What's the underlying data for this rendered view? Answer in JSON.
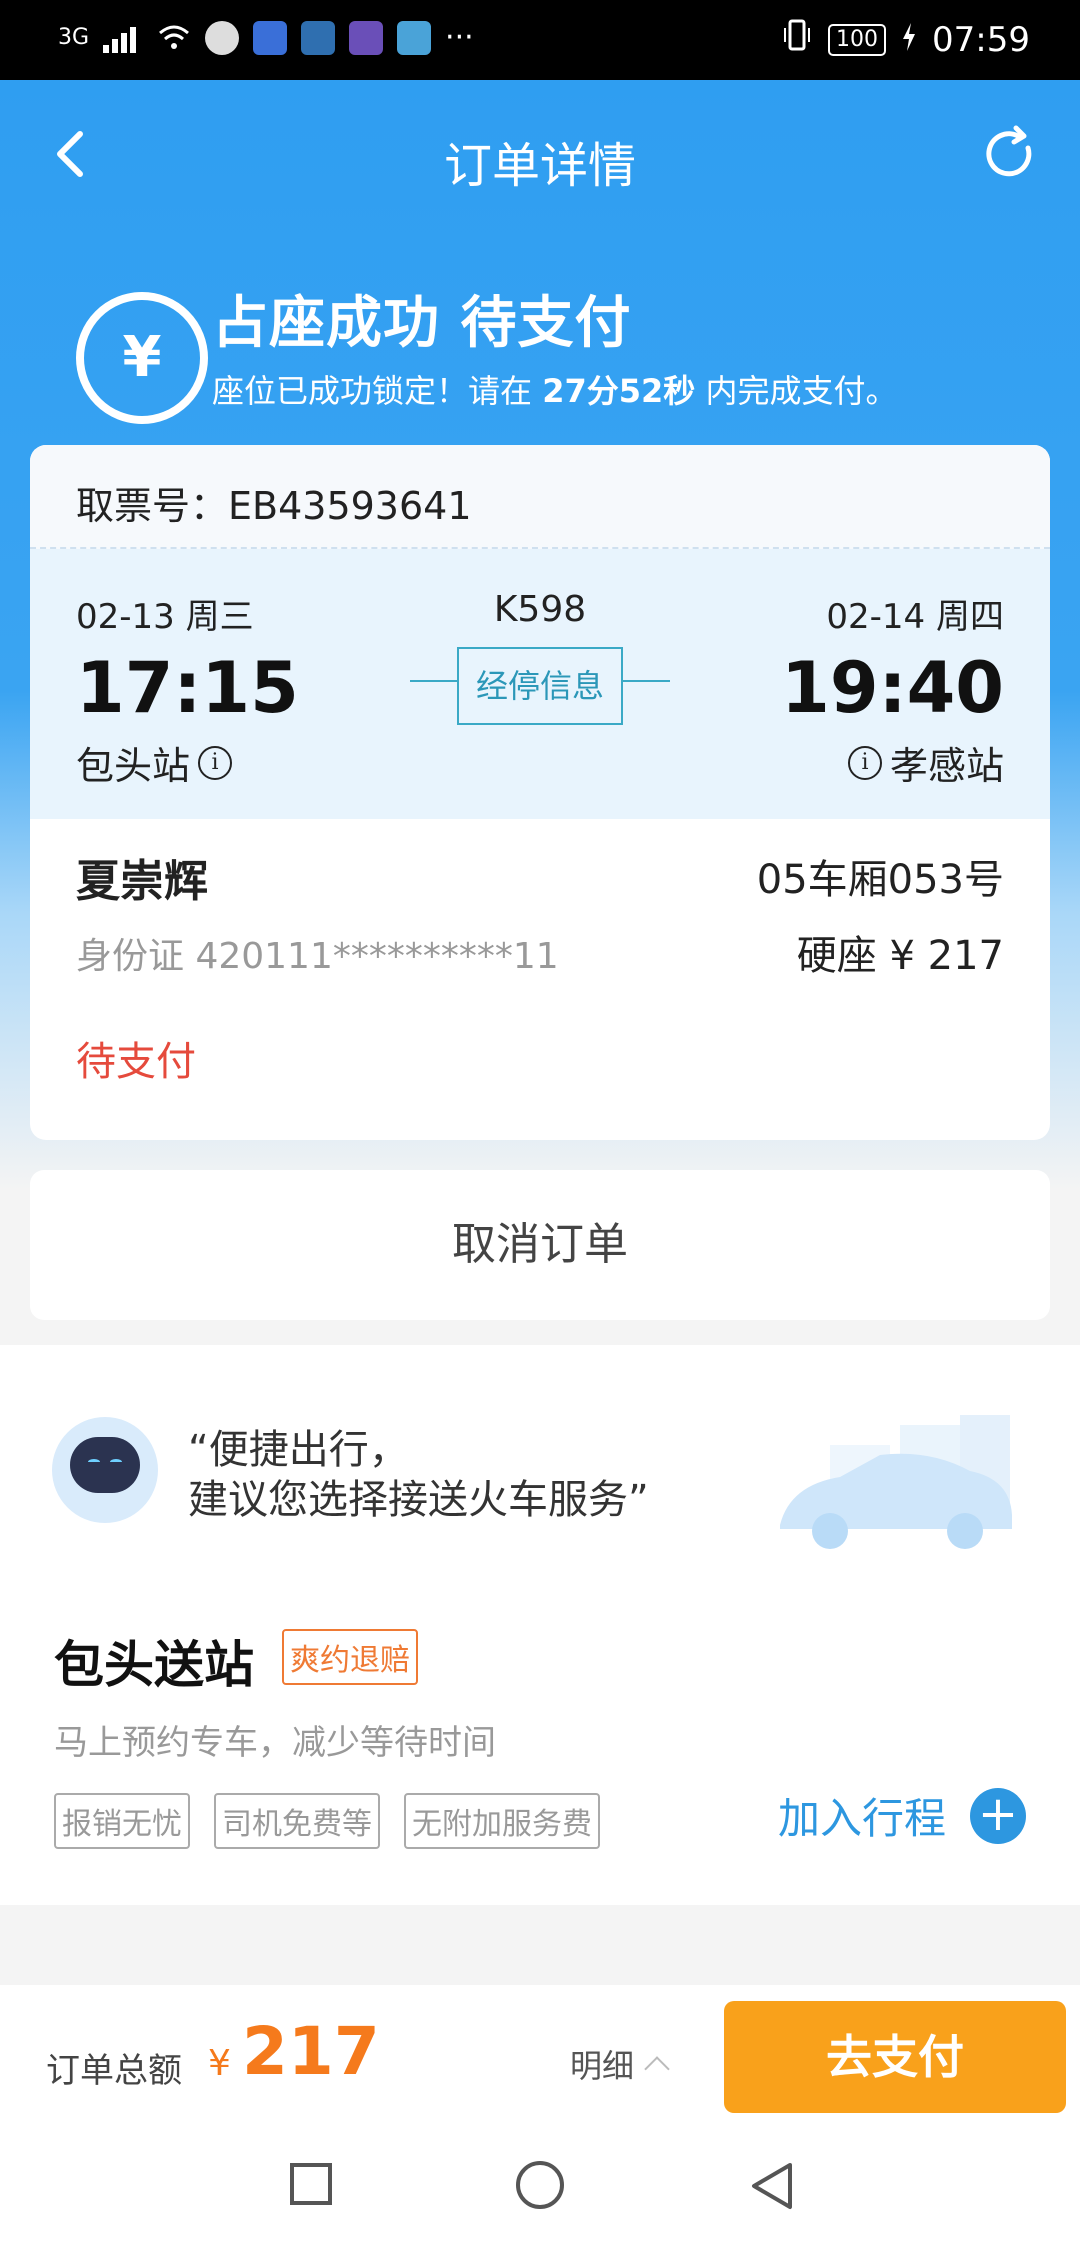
{
  "statusbar": {
    "network": "3G",
    "more": "···",
    "battery": "100",
    "time": "07:59"
  },
  "nav": {
    "title": "订单详情",
    "back_icon": "back-chevron-icon",
    "refresh_icon": "refresh-icon"
  },
  "order_status": {
    "icon": "yen",
    "title": "占座成功  待支付",
    "subtitle_prefix": "座位已成功锁定！请在 ",
    "countdown": "27分52秒",
    "subtitle_suffix": " 内完成支付。"
  },
  "ticket": {
    "ticket_no_label": "取票号：",
    "ticket_no": "EB43593641",
    "departure": {
      "date": "02-13  周三",
      "time": "17:15",
      "station": "包头站"
    },
    "train_no": "K598",
    "stops_button": "经停信息",
    "arrival": {
      "date": "02-14  周四",
      "time": "19:40",
      "station": "孝感站"
    },
    "passenger": {
      "name": "夏崇辉",
      "seat": "05车厢053号",
      "id": "身份证 420111**********11",
      "price": "硬座 ¥ 217",
      "status": "待支付"
    }
  },
  "cancel_button": "取消订单",
  "service": {
    "quote_line1": "“便捷出行，",
    "quote_line2": "建议您选择接送火车服务”",
    "title": "包头送站",
    "badge": "爽约退赔",
    "desc": "马上预约专车，减少等待时间",
    "tags": [
      "报销无忧",
      "司机免费等",
      "无附加服务费"
    ],
    "add_trip": "加入行程"
  },
  "bottom": {
    "total_label": "订单总额",
    "currency": "¥",
    "total": "217",
    "detail": "明细",
    "pay_button": "去支付"
  },
  "colors": {
    "primary_blue": "#2f9ef1",
    "pay_orange": "#f9a11b",
    "amount_orange": "#f57a1c",
    "status_red": "#e54a3c",
    "link_blue": "#2d97e0"
  }
}
